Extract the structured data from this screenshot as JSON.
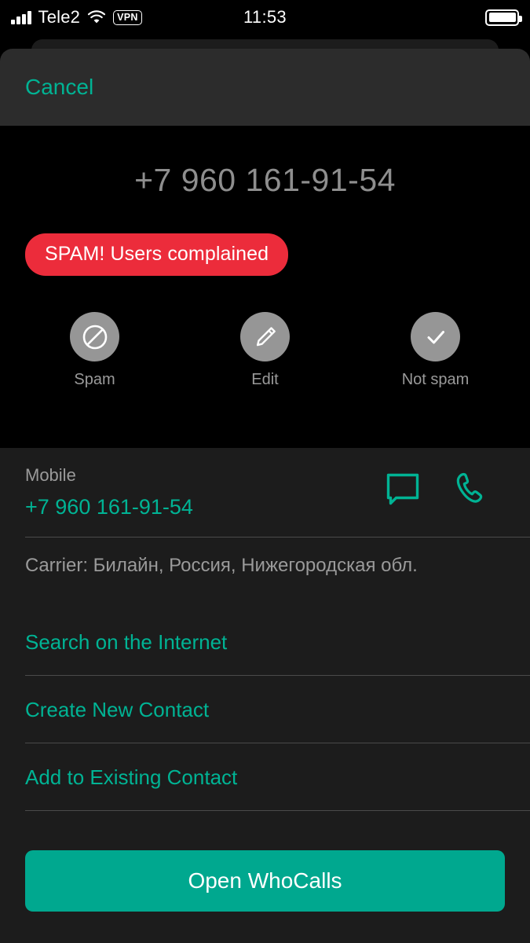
{
  "status_bar": {
    "carrier": "Tele2",
    "vpn": "VPN",
    "time": "11:53",
    "icons": {
      "signal": "signal-bars-icon",
      "wifi": "wifi-icon",
      "battery": "battery-full-icon"
    }
  },
  "sheet": {
    "cancel_label": "Cancel",
    "phone_number": "+7 960 161-91-54",
    "spam_badge": "SPAM! Users complained",
    "actions": [
      {
        "label": "Spam",
        "icon": "block-icon"
      },
      {
        "label": "Edit",
        "icon": "pencil-icon"
      },
      {
        "label": "Not spam",
        "icon": "check-icon"
      }
    ]
  },
  "details": {
    "phone_type_label": "Mobile",
    "phone_value": "+7 960 161-91-54",
    "message_icon": "message-bubble-icon",
    "call_icon": "phone-handset-icon",
    "carrier_info": "Carrier: Билайн, Россия, Нижегородская обл.",
    "links": [
      "Search on the Internet",
      "Create New Contact",
      "Add to Existing Contact"
    ]
  },
  "cta": {
    "label": "Open WhoCalls"
  },
  "colors": {
    "accent_teal": "#00b394",
    "button_teal": "#00a88f",
    "spam_red": "#ec2c3b",
    "panel_bg": "#1c1c1c",
    "header_bg": "#2c2c2c",
    "muted_text": "#9a9a9a"
  }
}
